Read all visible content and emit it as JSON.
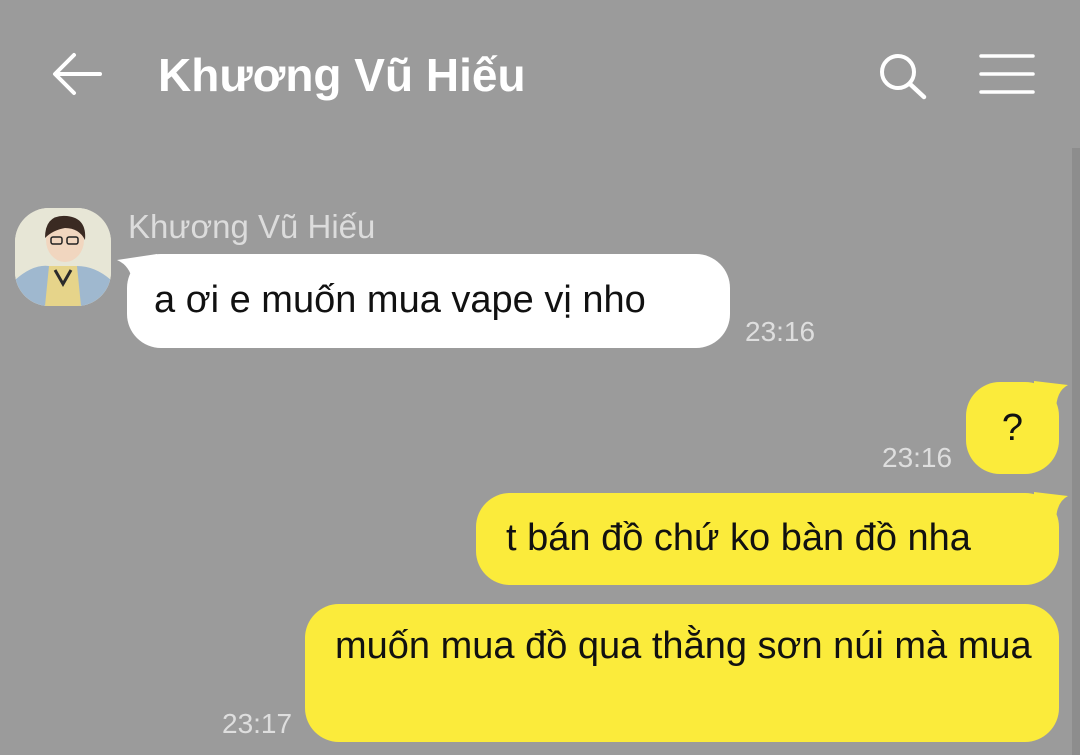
{
  "header": {
    "title": "Khương Vũ Hiếu",
    "back_icon": "arrow-left-icon",
    "search_icon": "search-icon",
    "menu_icon": "hamburger-menu-icon"
  },
  "colors": {
    "background": "#9b9b9b",
    "incoming_bubble": "#ffffff",
    "outgoing_bubble": "#fbeb3b",
    "timestamp": "#dedede"
  },
  "messages": [
    {
      "direction": "incoming",
      "sender": "Khương Vũ Hiếu",
      "text": "a ơi e muốn mua vape vị nho",
      "time": "23:16"
    },
    {
      "direction": "outgoing",
      "text": "?",
      "time": "23:16"
    },
    {
      "direction": "outgoing",
      "text": "t bán đồ chứ ko bàn đồ nha",
      "time": ""
    },
    {
      "direction": "outgoing",
      "text": "muốn mua đồ qua thằng sơn núi mà mua",
      "time": "23:17"
    }
  ]
}
